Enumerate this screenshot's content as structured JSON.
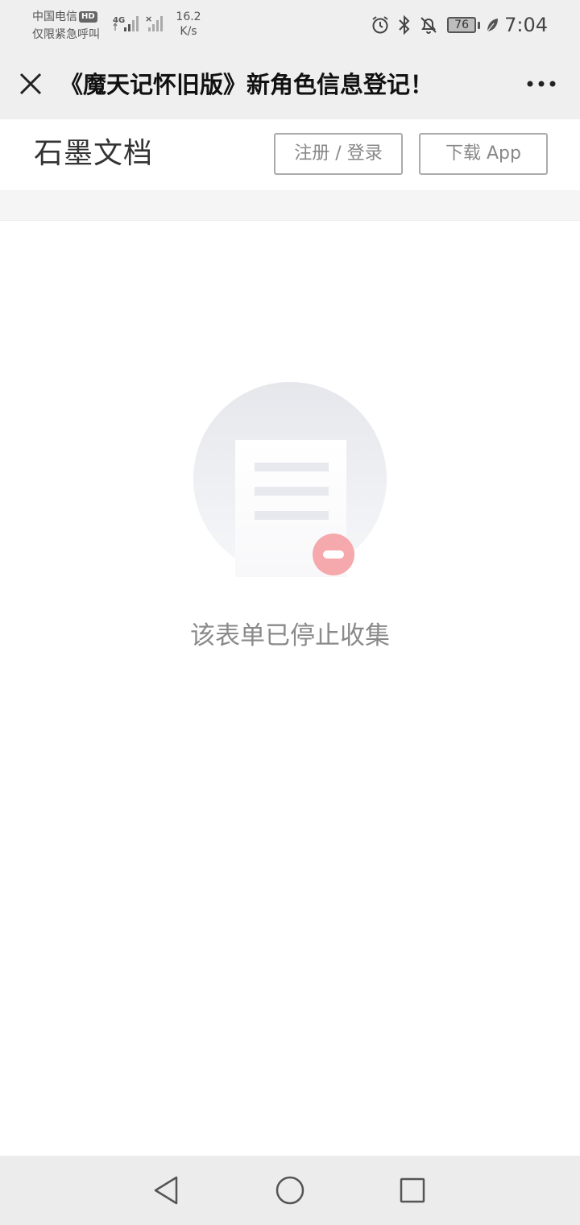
{
  "status_bar": {
    "carrier": "中国电信",
    "hd_badge": "HD",
    "emergency_text": "仅限紧急呼叫",
    "network_type": "4G",
    "net_speed_value": "16.2",
    "net_speed_unit": "K/s",
    "battery_level": "76",
    "time": "7:04",
    "icons": [
      "alarm-icon",
      "bluetooth-icon",
      "bell-muted-icon",
      "battery-icon",
      "leaf-icon"
    ]
  },
  "title_bar": {
    "title": "《魔天记怀旧版》新角色信息登记！",
    "close_icon": "close-icon",
    "more_icon": "more-icon"
  },
  "doc_header": {
    "logo": "石墨文档",
    "login_label": "注册 / 登录",
    "download_label": "下载 App"
  },
  "empty_state": {
    "message": "该表单已停止收集",
    "icon": "form-stopped-icon",
    "colors": {
      "circle": "#e8e9ee",
      "badge": "#f5a9ad"
    }
  },
  "nav_bar": {
    "icons": [
      "back-icon",
      "home-icon",
      "recent-apps-icon"
    ]
  },
  "colors": {
    "status_bar_bg": "#efefef",
    "button_border": "#ababab",
    "button_text": "#888888",
    "nav_bar_bg": "#ececec"
  }
}
